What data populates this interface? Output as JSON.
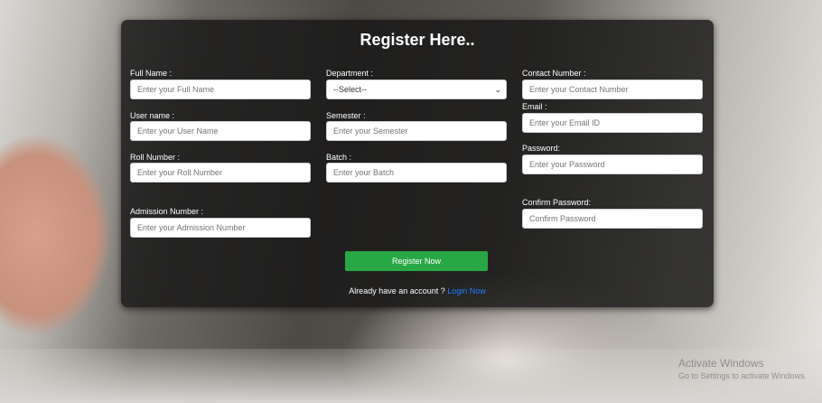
{
  "form": {
    "title": "Register Here..",
    "left": [
      {
        "label": "Full Name :",
        "placeholder": "Enter your Full Name"
      },
      {
        "label": "User name :",
        "placeholder": "Enter your User Name"
      },
      {
        "label": "Roll Number :",
        "placeholder": "Enter your Roll Number"
      },
      {
        "label": "Admission Number :",
        "placeholder": "Enter your Admission Number"
      }
    ],
    "middle": [
      {
        "label": "Department :",
        "value": "--Select--"
      },
      {
        "label": "Semester :",
        "placeholder": "Enter your Semester"
      },
      {
        "label": "Batch :",
        "placeholder": "Enter your Batch"
      }
    ],
    "right": [
      {
        "label": "Contact Number :",
        "placeholder": "Enter your Contact Number"
      },
      {
        "label": "Email :",
        "placeholder": "Enter your Email ID"
      },
      {
        "label": "Password:",
        "placeholder": "Enter your Password"
      },
      {
        "label": "Confirm Password:",
        "placeholder": "Confirm Password"
      }
    ],
    "submit_label": "Register Now",
    "login_prompt": "Already have an account ?",
    "login_link": "Login Now"
  },
  "watermark": {
    "title": "Activate Windows",
    "subtitle": "Go to Settings to activate Windows."
  },
  "colors": {
    "submit": "#28a745",
    "link": "#1e7fff"
  },
  "icons": {
    "select_arrow": "chevron-down-icon"
  }
}
